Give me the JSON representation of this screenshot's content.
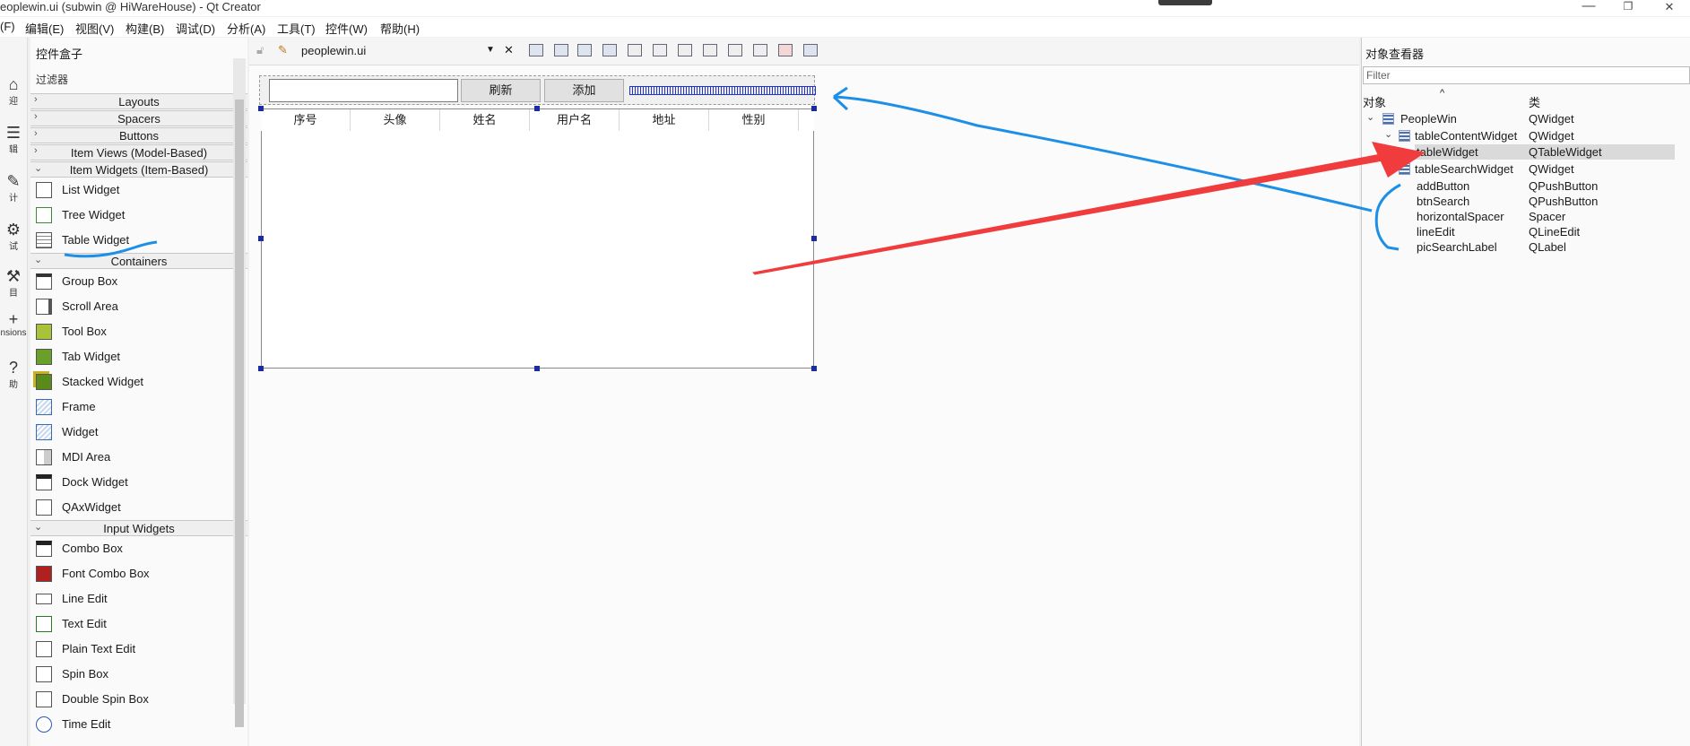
{
  "window": {
    "title": "eoplewin.ui (subwin @ HiWareHouse) - Qt Creator",
    "min": "—",
    "max": "❐",
    "close": "✕"
  },
  "menu": [
    "(F)",
    "编辑(E)",
    "视图(V)",
    "构建(B)",
    "调试(D)",
    "分析(A)",
    "工具(T)",
    "控件(W)",
    "帮助(H)"
  ],
  "modes": [
    {
      "icon": "⌂",
      "label": "迎"
    },
    {
      "icon": "☰",
      "label": "辑"
    },
    {
      "icon": "✎",
      "label": "计"
    },
    {
      "icon": "⚙",
      "label": "试"
    },
    {
      "icon": "⚒",
      "label": "目"
    },
    {
      "icon": "+",
      "label": "nsions"
    },
    {
      "icon": "?",
      "label": "助"
    }
  ],
  "widgetbox": {
    "title": "控件盒子",
    "filter": "过滤器",
    "categories": {
      "layouts": "Layouts",
      "spacers": "Spacers",
      "buttons": "Buttons",
      "item_views": "Item Views (Model-Based)",
      "item_widgets": "Item Widgets (Item-Based)",
      "containers": "Containers",
      "input_widgets": "Input Widgets"
    },
    "item_widgets": [
      "List Widget",
      "Tree Widget",
      "Table Widget"
    ],
    "containers": [
      "Group Box",
      "Scroll Area",
      "Tool Box",
      "Tab Widget",
      "Stacked Widget",
      "Frame",
      "Widget",
      "MDI Area",
      "Dock Widget",
      "QAxWidget"
    ],
    "input_widgets": [
      "Combo Box",
      "Font Combo Box",
      "Line Edit",
      "Text Edit",
      "Plain Text Edit",
      "Spin Box",
      "Double Spin Box",
      "Time Edit"
    ]
  },
  "editor": {
    "file": "peoplewin.ui",
    "close": "✕",
    "form": {
      "refresh_label": "刷新",
      "add_label": "添加",
      "columns": [
        "序号",
        "头像",
        "姓名",
        "用户名",
        "地址",
        "性别"
      ]
    }
  },
  "inspector": {
    "title": "对象查看器",
    "filter_placeholder": "Filter",
    "col_object": "对象",
    "col_class": "类",
    "rows": [
      {
        "name": "PeopleWin",
        "cls": "QWidget"
      },
      {
        "name": "tableContentWidget",
        "cls": "QWidget"
      },
      {
        "name": "tableWidget",
        "cls": "QTableWidget"
      },
      {
        "name": "tableSearchWidget",
        "cls": "QWidget"
      },
      {
        "name": "addButton",
        "cls": "QPushButton"
      },
      {
        "name": "btnSearch",
        "cls": "QPushButton"
      },
      {
        "name": "horizontalSpacer",
        "cls": "Spacer"
      },
      {
        "name": "lineEdit",
        "cls": "QLineEdit"
      },
      {
        "name": "picSearchLabel",
        "cls": "QLabel"
      }
    ]
  },
  "colors": {
    "annotation_blue": "#1e8fe6",
    "annotation_red": "#f03c3c",
    "selection_bg": "#dadada",
    "handle": "#1c2c9e"
  }
}
